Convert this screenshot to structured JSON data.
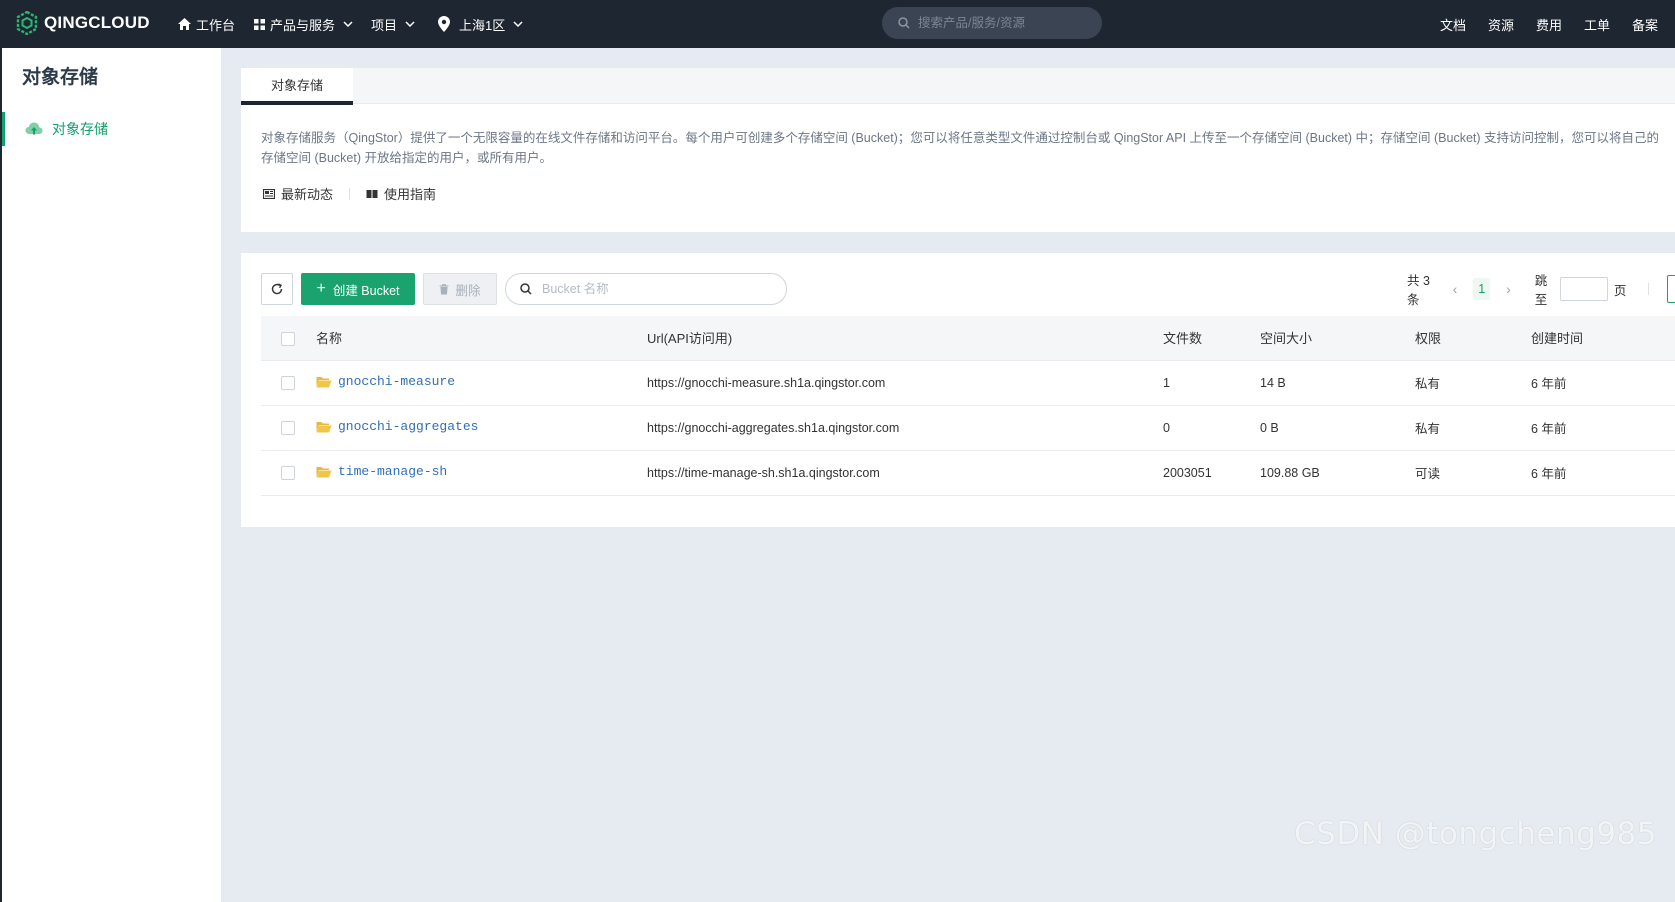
{
  "header": {
    "logo_text": "QINGCLOUD",
    "nav": {
      "workbench": "工作台",
      "products": "产品与服务",
      "projects": "项目",
      "region": "上海1区"
    },
    "search_placeholder": "搜索产品/服务/资源",
    "right_links": [
      "文档",
      "资源",
      "费用",
      "工单",
      "备案"
    ]
  },
  "sidebar": {
    "title": "对象存储",
    "items": [
      {
        "label": "对象存储",
        "icon": "cloud-upload-icon"
      }
    ]
  },
  "main": {
    "tabs": [
      {
        "label": "对象存储",
        "active": true
      }
    ],
    "description": "对象存储服务（QingStor）提供了一个无限容量的在线文件存储和访问平台。每个用户可创建多个存储空间 (Bucket)；您可以将任意类型文件通过控制台或 QingStor API 上传至一个存储空间 (Bucket) 中；存储空间 (Bucket) 支持访问控制，您可以将自己的存储空间 (Bucket) 开放给指定的用户，或所有用户。",
    "links": {
      "news": "最新动态",
      "guide": "使用指南"
    }
  },
  "toolbar": {
    "create_label": "创建 Bucket",
    "delete_label": "删除",
    "search_placeholder": "Bucket 名称"
  },
  "pagination": {
    "total_text": "共 3 条",
    "current_page": "1",
    "jump_label": "跳至",
    "page_suffix": "页"
  },
  "table": {
    "columns": [
      "名称",
      "Url(API访问用)",
      "文件数",
      "空间大小",
      "权限",
      "创建时间"
    ],
    "rows": [
      {
        "name": "gnocchi-measure",
        "url": "https://gnocchi-measure.sh1a.qingstor.com",
        "files": "1",
        "size": "14 B",
        "permission": "私有",
        "created": "6 年前"
      },
      {
        "name": "gnocchi-aggregates",
        "url": "https://gnocchi-aggregates.sh1a.qingstor.com",
        "files": "0",
        "size": "0 B",
        "permission": "私有",
        "created": "6 年前"
      },
      {
        "name": "time-manage-sh",
        "url": "https://time-manage-sh.sh1a.qingstor.com",
        "files": "2003051",
        "size": "109.88 GB",
        "permission": "可读",
        "created": "6 年前"
      }
    ]
  },
  "watermark": "CSDN @tongcheng985",
  "colors": {
    "accent": "#1aa36f",
    "topbar": "#1e2632",
    "link": "#2f6fb7",
    "folder": "#e8b93a"
  }
}
